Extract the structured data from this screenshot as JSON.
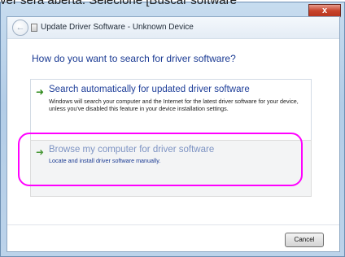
{
  "caption": "ver será aberta. Selecione [Buscar software",
  "window": {
    "close_label": "x"
  },
  "dialog": {
    "title": "Update Driver Software - Unknown Device",
    "question": "How do you want to search for driver software?",
    "options": [
      {
        "title": "Search automatically for updated driver software",
        "description": "Windows will search your computer and the Internet for the latest driver software for your device, unless you've disabled this feature in your device installation settings."
      },
      {
        "title": "Browse my computer for driver software",
        "description": "Locate and install driver software manually."
      }
    ],
    "cancel_label": "Cancel"
  },
  "colors": {
    "highlight": "#ff00ff",
    "link_blue": "#1e3e99",
    "arrow_green": "#2f8b1c"
  },
  "icons": [
    "back-arrow-icon",
    "device-icon",
    "green-arrow-icon",
    "close-icon"
  ]
}
